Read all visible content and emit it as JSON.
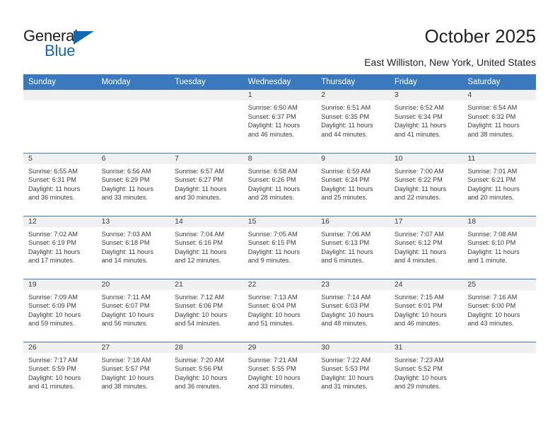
{
  "brand": {
    "name_part1": "General",
    "name_part2": "Blue",
    "accent_color": "#1268b3"
  },
  "header": {
    "title": "October 2025",
    "location": "East Williston, New York, United States",
    "header_bg_color": "#3a79bd"
  },
  "weekday_headers": [
    "Sunday",
    "Monday",
    "Tuesday",
    "Wednesday",
    "Thursday",
    "Friday",
    "Saturday"
  ],
  "labels": {
    "sunrise": "Sunrise:",
    "sunset": "Sunset:",
    "daylight": "Daylight:"
  },
  "weeks": [
    [
      {
        "empty": true
      },
      {
        "empty": true
      },
      {
        "empty": true
      },
      {
        "day": "1",
        "sunrise": "Sunrise: 6:50 AM",
        "sunset": "Sunset: 6:37 PM",
        "daylight_line1": "Daylight: 11 hours",
        "daylight_line2": "and 46 minutes."
      },
      {
        "day": "2",
        "sunrise": "Sunrise: 6:51 AM",
        "sunset": "Sunset: 6:35 PM",
        "daylight_line1": "Daylight: 11 hours",
        "daylight_line2": "and 44 minutes."
      },
      {
        "day": "3",
        "sunrise": "Sunrise: 6:52 AM",
        "sunset": "Sunset: 6:34 PM",
        "daylight_line1": "Daylight: 11 hours",
        "daylight_line2": "and 41 minutes."
      },
      {
        "day": "4",
        "sunrise": "Sunrise: 6:54 AM",
        "sunset": "Sunset: 6:32 PM",
        "daylight_line1": "Daylight: 11 hours",
        "daylight_line2": "and 38 minutes."
      }
    ],
    [
      {
        "day": "5",
        "sunrise": "Sunrise: 6:55 AM",
        "sunset": "Sunset: 6:31 PM",
        "daylight_line1": "Daylight: 11 hours",
        "daylight_line2": "and 36 minutes."
      },
      {
        "day": "6",
        "sunrise": "Sunrise: 6:56 AM",
        "sunset": "Sunset: 6:29 PM",
        "daylight_line1": "Daylight: 11 hours",
        "daylight_line2": "and 33 minutes."
      },
      {
        "day": "7",
        "sunrise": "Sunrise: 6:57 AM",
        "sunset": "Sunset: 6:27 PM",
        "daylight_line1": "Daylight: 11 hours",
        "daylight_line2": "and 30 minutes."
      },
      {
        "day": "8",
        "sunrise": "Sunrise: 6:58 AM",
        "sunset": "Sunset: 6:26 PM",
        "daylight_line1": "Daylight: 11 hours",
        "daylight_line2": "and 28 minutes."
      },
      {
        "day": "9",
        "sunrise": "Sunrise: 6:59 AM",
        "sunset": "Sunset: 6:24 PM",
        "daylight_line1": "Daylight: 11 hours",
        "daylight_line2": "and 25 minutes."
      },
      {
        "day": "10",
        "sunrise": "Sunrise: 7:00 AM",
        "sunset": "Sunset: 6:22 PM",
        "daylight_line1": "Daylight: 11 hours",
        "daylight_line2": "and 22 minutes."
      },
      {
        "day": "11",
        "sunrise": "Sunrise: 7:01 AM",
        "sunset": "Sunset: 6:21 PM",
        "daylight_line1": "Daylight: 11 hours",
        "daylight_line2": "and 20 minutes."
      }
    ],
    [
      {
        "day": "12",
        "sunrise": "Sunrise: 7:02 AM",
        "sunset": "Sunset: 6:19 PM",
        "daylight_line1": "Daylight: 11 hours",
        "daylight_line2": "and 17 minutes."
      },
      {
        "day": "13",
        "sunrise": "Sunrise: 7:03 AM",
        "sunset": "Sunset: 6:18 PM",
        "daylight_line1": "Daylight: 11 hours",
        "daylight_line2": "and 14 minutes."
      },
      {
        "day": "14",
        "sunrise": "Sunrise: 7:04 AM",
        "sunset": "Sunset: 6:16 PM",
        "daylight_line1": "Daylight: 11 hours",
        "daylight_line2": "and 12 minutes."
      },
      {
        "day": "15",
        "sunrise": "Sunrise: 7:05 AM",
        "sunset": "Sunset: 6:15 PM",
        "daylight_line1": "Daylight: 11 hours",
        "daylight_line2": "and 9 minutes."
      },
      {
        "day": "16",
        "sunrise": "Sunrise: 7:06 AM",
        "sunset": "Sunset: 6:13 PM",
        "daylight_line1": "Daylight: 11 hours",
        "daylight_line2": "and 6 minutes."
      },
      {
        "day": "17",
        "sunrise": "Sunrise: 7:07 AM",
        "sunset": "Sunset: 6:12 PM",
        "daylight_line1": "Daylight: 11 hours",
        "daylight_line2": "and 4 minutes."
      },
      {
        "day": "18",
        "sunrise": "Sunrise: 7:08 AM",
        "sunset": "Sunset: 6:10 PM",
        "daylight_line1": "Daylight: 11 hours",
        "daylight_line2": "and 1 minute."
      }
    ],
    [
      {
        "day": "19",
        "sunrise": "Sunrise: 7:09 AM",
        "sunset": "Sunset: 6:09 PM",
        "daylight_line1": "Daylight: 10 hours",
        "daylight_line2": "and 59 minutes."
      },
      {
        "day": "20",
        "sunrise": "Sunrise: 7:11 AM",
        "sunset": "Sunset: 6:07 PM",
        "daylight_line1": "Daylight: 10 hours",
        "daylight_line2": "and 56 minutes."
      },
      {
        "day": "21",
        "sunrise": "Sunrise: 7:12 AM",
        "sunset": "Sunset: 6:06 PM",
        "daylight_line1": "Daylight: 10 hours",
        "daylight_line2": "and 54 minutes."
      },
      {
        "day": "22",
        "sunrise": "Sunrise: 7:13 AM",
        "sunset": "Sunset: 6:04 PM",
        "daylight_line1": "Daylight: 10 hours",
        "daylight_line2": "and 51 minutes."
      },
      {
        "day": "23",
        "sunrise": "Sunrise: 7:14 AM",
        "sunset": "Sunset: 6:03 PM",
        "daylight_line1": "Daylight: 10 hours",
        "daylight_line2": "and 48 minutes."
      },
      {
        "day": "24",
        "sunrise": "Sunrise: 7:15 AM",
        "sunset": "Sunset: 6:01 PM",
        "daylight_line1": "Daylight: 10 hours",
        "daylight_line2": "and 46 minutes."
      },
      {
        "day": "25",
        "sunrise": "Sunrise: 7:16 AM",
        "sunset": "Sunset: 6:00 PM",
        "daylight_line1": "Daylight: 10 hours",
        "daylight_line2": "and 43 minutes."
      }
    ],
    [
      {
        "day": "26",
        "sunrise": "Sunrise: 7:17 AM",
        "sunset": "Sunset: 5:59 PM",
        "daylight_line1": "Daylight: 10 hours",
        "daylight_line2": "and 41 minutes."
      },
      {
        "day": "27",
        "sunrise": "Sunrise: 7:18 AM",
        "sunset": "Sunset: 5:57 PM",
        "daylight_line1": "Daylight: 10 hours",
        "daylight_line2": "and 38 minutes."
      },
      {
        "day": "28",
        "sunrise": "Sunrise: 7:20 AM",
        "sunset": "Sunset: 5:56 PM",
        "daylight_line1": "Daylight: 10 hours",
        "daylight_line2": "and 36 minutes."
      },
      {
        "day": "29",
        "sunrise": "Sunrise: 7:21 AM",
        "sunset": "Sunset: 5:55 PM",
        "daylight_line1": "Daylight: 10 hours",
        "daylight_line2": "and 33 minutes."
      },
      {
        "day": "30",
        "sunrise": "Sunrise: 7:22 AM",
        "sunset": "Sunset: 5:53 PM",
        "daylight_line1": "Daylight: 10 hours",
        "daylight_line2": "and 31 minutes."
      },
      {
        "day": "31",
        "sunrise": "Sunrise: 7:23 AM",
        "sunset": "Sunset: 5:52 PM",
        "daylight_line1": "Daylight: 10 hours",
        "daylight_line2": "and 29 minutes."
      },
      {
        "empty": true
      }
    ]
  ]
}
